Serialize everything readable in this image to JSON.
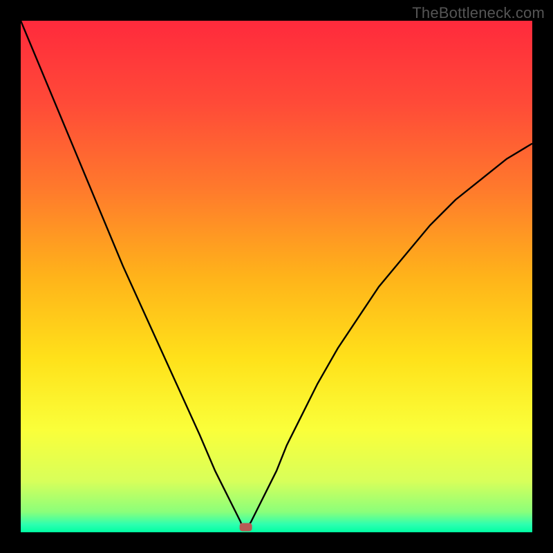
{
  "watermark": "TheBottleneck.com",
  "chart_data": {
    "type": "line",
    "title": "",
    "xlabel": "",
    "ylabel": "",
    "xlim": [
      0,
      100
    ],
    "ylim": [
      0,
      100
    ],
    "curve_left": {
      "x": [
        0,
        5,
        10,
        15,
        20,
        25,
        30,
        35,
        38,
        40,
        41,
        42,
        43,
        43.5
      ],
      "y": [
        100,
        88,
        76,
        64,
        52,
        41,
        30,
        19,
        12,
        8,
        6,
        4,
        2,
        0.5
      ]
    },
    "curve_right": {
      "x": [
        44,
        45,
        46,
        48,
        50,
        52,
        55,
        58,
        62,
        66,
        70,
        75,
        80,
        85,
        90,
        95,
        100
      ],
      "y": [
        0.5,
        2,
        4,
        8,
        12,
        17,
        23,
        29,
        36,
        42,
        48,
        54,
        60,
        65,
        69,
        73,
        76
      ]
    },
    "marker": {
      "x": 44,
      "y": 1
    },
    "gradient_stops": [
      {
        "offset": 0.0,
        "color": "#ff2a3c"
      },
      {
        "offset": 0.16,
        "color": "#ff4a38"
      },
      {
        "offset": 0.33,
        "color": "#ff7a2c"
      },
      {
        "offset": 0.5,
        "color": "#ffb31a"
      },
      {
        "offset": 0.66,
        "color": "#ffe11a"
      },
      {
        "offset": 0.8,
        "color": "#faff3a"
      },
      {
        "offset": 0.9,
        "color": "#d8ff5a"
      },
      {
        "offset": 0.96,
        "color": "#8bff7a"
      },
      {
        "offset": 0.985,
        "color": "#2cffb0"
      },
      {
        "offset": 1.0,
        "color": "#00ffa2"
      }
    ]
  }
}
